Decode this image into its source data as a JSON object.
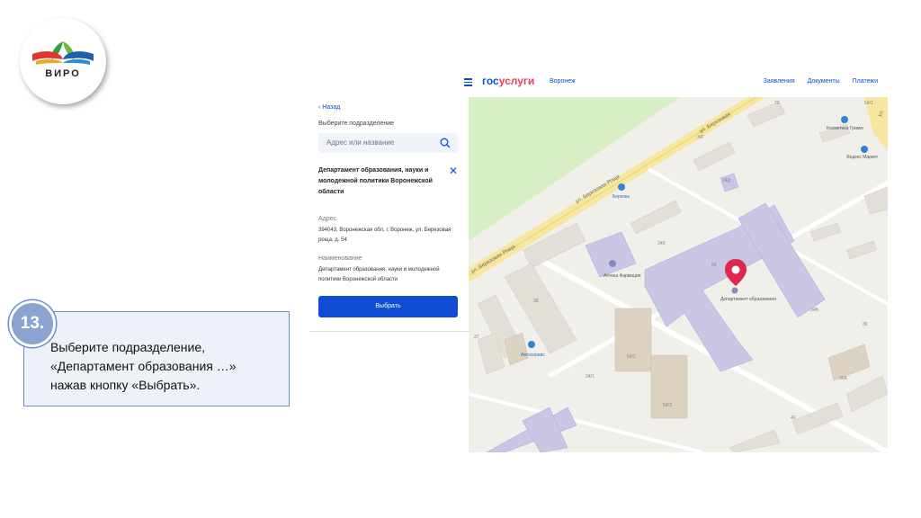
{
  "logo": {
    "text": "ВИРО"
  },
  "header": {
    "brand_part1": "гос",
    "brand_part2": "услуги",
    "city": "Воронеж",
    "nav": [
      "Заявления",
      "Документы",
      "Платежи"
    ]
  },
  "panel": {
    "back": "‹ Назад",
    "pick_label": "Выберите подразделение",
    "search_placeholder": "Адрес или название",
    "selected_name": "Департамент образования, науки и молодежной политики Воронежской области",
    "address_label": "Адрес",
    "address_value": "394043, Воронежская обл, г. Воронеж, ул. Березовая роща, д. 54",
    "name_label": "Наименование",
    "name_value": "Департамент образования, науки и молодежной политики Воронежской области",
    "select_button": "Выбрать"
  },
  "map": {
    "street_main": "ул. Березовая Роща",
    "street_main2": "ул. Березовая Роща",
    "street_top": "ул. Березовая",
    "street_corner": "ул.",
    "poi": [
      {
        "name": "Березка"
      },
      {
        "name": "Аптека Фармация"
      },
      {
        "name": "Департамент образования"
      },
      {
        "name": "Косметика Гримм"
      },
      {
        "name": "Яндекс Маркет"
      },
      {
        "name": "Автосервис"
      }
    ],
    "house_numbers": [
      "72",
      "34Г",
      "34Д",
      "34Б",
      "54",
      "34В",
      "38",
      "37",
      "24/1",
      "54/2",
      "54/3",
      "36А",
      "36",
      "40",
      "54/1"
    ]
  },
  "step": {
    "number": "13.",
    "lines": [
      "Выберите подразделение,",
      "«Департамент образования …»",
      "нажав кнопку «Выбрать»."
    ]
  },
  "colors": {
    "accent": "#0d4cd3",
    "brand_red": "#ee3f58",
    "callout_border": "#6b8dc4",
    "callout_circle": "#8aa4cf"
  }
}
